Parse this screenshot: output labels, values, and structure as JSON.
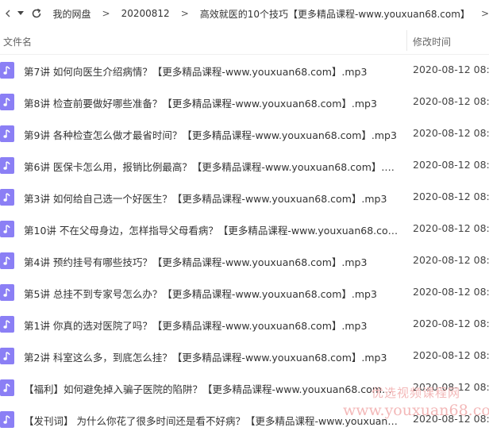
{
  "toolbar": {
    "back_icon": "chevron-left-icon",
    "dropdown_icon": "caret-down-icon",
    "refresh_icon": "refresh-icon",
    "breadcrumbs": [
      "我的网盘",
      "20200812",
      "高效就医的10个技巧【更多精品课程-www.youxuan68.com】"
    ],
    "separator": ">"
  },
  "header": {
    "name_col": "文件名",
    "time_col": "修改时间"
  },
  "files": [
    {
      "name": "第7讲 如何向医生介绍病情？【更多精品课程-www.youxuan68.com】.mp3",
      "time": "2020-08-12 08:57"
    },
    {
      "name": "第8讲 检查前要做好哪些准备？【更多精品课程-www.youxuan68.com】.mp3",
      "time": "2020-08-12 08:57"
    },
    {
      "name": "第9讲 各种检查怎么做才最省时间？【更多精品课程-www.youxuan68.com】.mp3",
      "time": "2020-08-12 08:57"
    },
    {
      "name": "第6讲 医保卡怎么用，报销比例最高？【更多精品课程-www.youxuan68.com】.mp3",
      "time": "2020-08-12 08:57"
    },
    {
      "name": "第3讲 如何给自己选一个好医生？【更多精品课程-www.youxuan68.com】.mp3",
      "time": "2020-08-12 08:57"
    },
    {
      "name": "第10讲 不在父母身边，怎样指导父母看病？【更多精品课程-www.youxuan68.com】....",
      "time": "2020-08-12 08:57"
    },
    {
      "name": "第4讲 预约挂号有哪些技巧？【更多精品课程-www.youxuan68.com】.mp3",
      "time": "2020-08-12 08:57"
    },
    {
      "name": "第5讲 总挂不到专家号怎么办？【更多精品课程-www.youxuan68.com】.mp3",
      "time": "2020-08-12 08:57"
    },
    {
      "name": "第1讲 你真的选对医院了吗？【更多精品课程-www.youxuan68.com】.mp3",
      "time": "2020-08-12 08:57"
    },
    {
      "name": "第2讲 科室这么多，到底怎么挂？【更多精品课程-www.youxuan68.com】.mp3",
      "time": "2020-08-12 08:57"
    },
    {
      "name": "【福利】如何避免掉入骗子医院的陷阱？【更多精品课程-www.youxuan68.com】.mp3",
      "time": "2020-08-12 08:57"
    },
    {
      "name": "【发刊词】 为什么你花了很多时间还是看不好病？【更多精品课程-www.youxuan68.com】",
      "time": "2020-08-12 08:57"
    }
  ],
  "file_icon": "music-note-icon",
  "colors": {
    "file_icon_bg": "#8b7ff5",
    "watermark": "#f3b8b8"
  },
  "watermark": {
    "line1": "优选视频课程网",
    "line2": "www.youxuan68.com"
  }
}
